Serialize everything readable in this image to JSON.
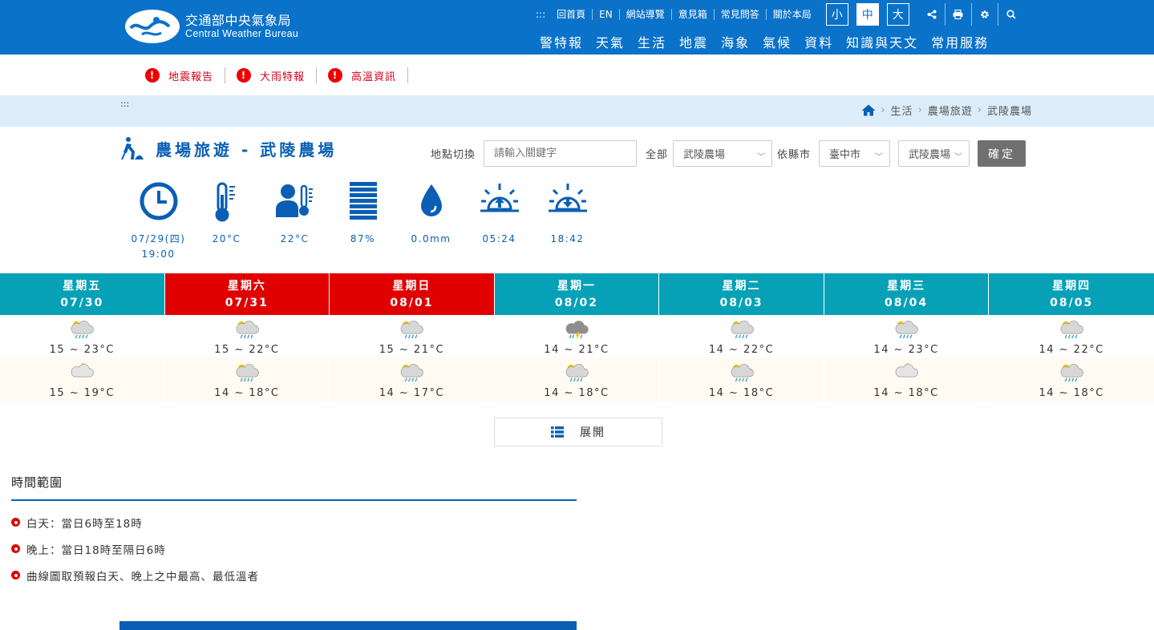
{
  "header": {
    "logo_zh": "交通部中央氣象局",
    "logo_en": "Central Weather Bureau",
    "util_links": [
      ":::",
      "回首頁",
      "EN",
      "網站導覽",
      "意見箱",
      "常見問答",
      "關於本局"
    ],
    "font_sizes": {
      "small": "小",
      "medium": "中",
      "large": "大",
      "selected": "中"
    },
    "util_icons": [
      "share-icon",
      "print-icon",
      "gear-icon",
      "search-icon"
    ],
    "main_nav": [
      "警特報",
      "天氣",
      "生活",
      "地震",
      "海象",
      "氣候",
      "資料",
      "知識與天文",
      "常用服務"
    ],
    "brand_color": "#0a72c9"
  },
  "alerts": [
    "地震報告",
    "大雨特報",
    "高溫資訊"
  ],
  "breadcrumb": {
    "accesskey": ":::",
    "items": [
      "生活",
      "農場旅遊",
      "武陵農場"
    ]
  },
  "page": {
    "title": "農場旅遊 - 武陵農場"
  },
  "selector": {
    "location_label": "地點切換",
    "search_placeholder": "請輸入關鍵字",
    "all_label": "全部",
    "farm_value": "武陵農場",
    "by_county_label": "依縣市",
    "county_value": "臺中市",
    "farm2_value": "武陵農場",
    "confirm_label": "確定"
  },
  "observation": [
    {
      "icon": "clock-icon",
      "value": "07/29(四)",
      "value2": "19:00"
    },
    {
      "icon": "thermometer-icon",
      "value": "20°C"
    },
    {
      "icon": "feels-like-icon",
      "value": "22°C"
    },
    {
      "icon": "humidity-icon",
      "value": "87%"
    },
    {
      "icon": "rain-drop-icon",
      "value": "0.0mm"
    },
    {
      "icon": "sunrise-icon",
      "value": "05:24"
    },
    {
      "icon": "sunset-icon",
      "value": "18:42"
    }
  ],
  "forecast": {
    "days": [
      {
        "weekday": "星期五",
        "date": "07/30",
        "holiday": false,
        "day_icon": "rain-icon",
        "day_temp": "15 ~ 23°C",
        "night_icon": "cloudy-moon-icon",
        "night_temp": "15 ~ 19°C"
      },
      {
        "weekday": "星期六",
        "date": "07/31",
        "holiday": true,
        "day_icon": "rain-icon",
        "day_temp": "15 ~ 22°C",
        "night_icon": "rain-icon",
        "night_temp": "14 ~ 18°C"
      },
      {
        "weekday": "星期日",
        "date": "08/01",
        "holiday": true,
        "day_icon": "rain-icon",
        "day_temp": "15 ~ 21°C",
        "night_icon": "rain-icon",
        "night_temp": "14 ~ 17°C"
      },
      {
        "weekday": "星期一",
        "date": "08/02",
        "holiday": false,
        "day_icon": "thunder-rain-icon",
        "day_temp": "14 ~ 21°C",
        "night_icon": "rain-icon",
        "night_temp": "14 ~ 18°C"
      },
      {
        "weekday": "星期二",
        "date": "08/03",
        "holiday": false,
        "day_icon": "rain-icon",
        "day_temp": "14 ~ 22°C",
        "night_icon": "rain-icon",
        "night_temp": "14 ~ 18°C"
      },
      {
        "weekday": "星期三",
        "date": "08/04",
        "holiday": false,
        "day_icon": "rain-icon",
        "day_temp": "14 ~ 23°C",
        "night_icon": "cloudy-moon-icon",
        "night_temp": "14 ~ 18°C"
      },
      {
        "weekday": "星期四",
        "date": "08/05",
        "holiday": false,
        "day_icon": "rain-icon",
        "day_temp": "14 ~ 22°C",
        "night_icon": "rain-icon",
        "night_temp": "14 ~ 18°C"
      }
    ],
    "colors": {
      "weekday": "#06a1b7",
      "holiday": "#e00000"
    }
  },
  "expand_label": "展開",
  "time_range": {
    "heading": "時間範圍",
    "items": [
      "白天：當日6時至18時",
      "晚上：當日18時至隔日6時",
      "曲線圖取預報白天、晚上之中最高、最低溫者"
    ]
  }
}
